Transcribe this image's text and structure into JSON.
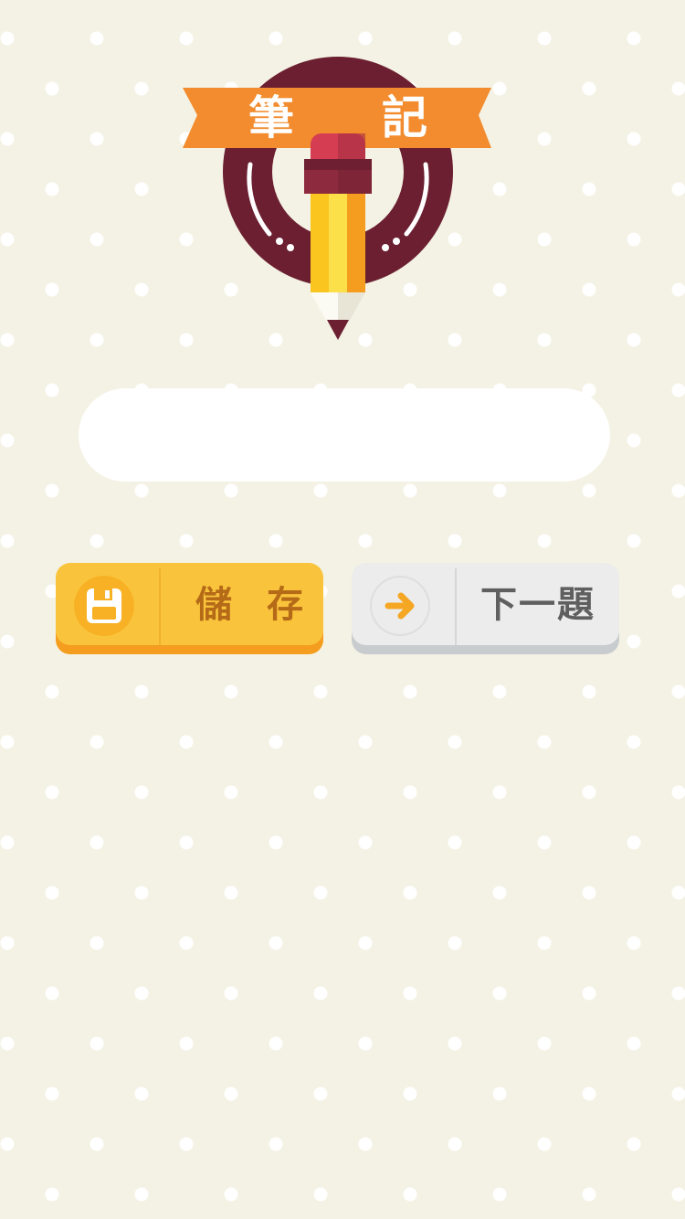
{
  "header": {
    "title_left": "筆",
    "title_right": "記",
    "emblem_icon": "pencil-icon"
  },
  "note": {
    "value": "",
    "placeholder": ""
  },
  "actions": {
    "save": {
      "label": "儲存",
      "icon": "floppy-disk-icon"
    },
    "next": {
      "label": "下一題",
      "icon": "arrow-right-icon"
    }
  },
  "colors": {
    "background": "#f4f2e4",
    "ribbon": "#f28c2e",
    "ring": "#6b1f31",
    "save_button": "#f9c43c",
    "save_text": "#b46a17",
    "next_button": "#ececec",
    "next_arrow": "#f5a623"
  }
}
